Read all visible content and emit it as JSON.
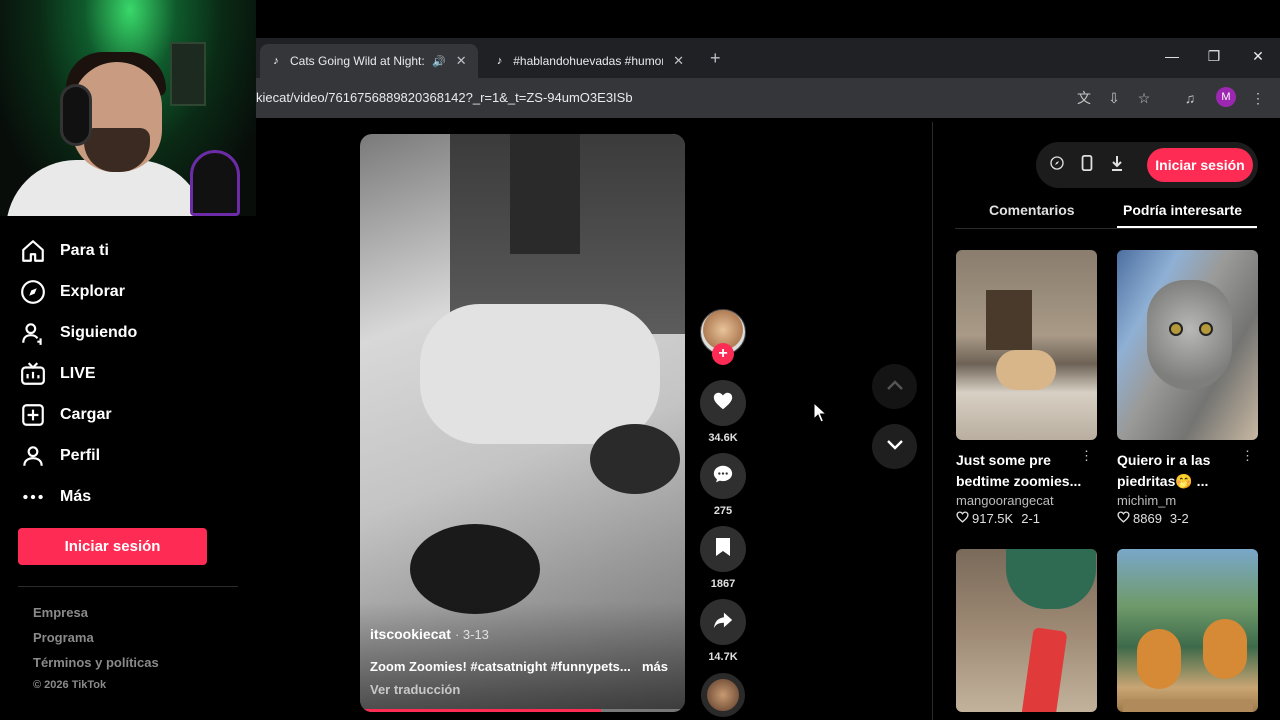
{
  "browser": {
    "tabs": [
      {
        "title": "Cats Going Wild at Night: T",
        "active": true
      },
      {
        "title": "#hablandohuevadas #humor | I",
        "active": false
      }
    ],
    "url": "kiecat/video/7616756889820368142?_r=1&_t=ZS-94umO3E3ISb",
    "profile_initial": "M"
  },
  "sidebar": {
    "items": [
      {
        "label": "Para ti",
        "icon": "home-icon"
      },
      {
        "label": "Explorar",
        "icon": "compass-icon"
      },
      {
        "label": "Siguiendo",
        "icon": "following-icon"
      },
      {
        "label": "LIVE",
        "icon": "live-icon"
      },
      {
        "label": "Cargar",
        "icon": "upload-icon"
      },
      {
        "label": "Perfil",
        "icon": "profile-icon"
      },
      {
        "label": "Más",
        "icon": "more-icon"
      }
    ],
    "login_label": "Iniciar sesión",
    "footer": [
      "Empresa",
      "Programa",
      "Términos y políticas"
    ],
    "copyright": "© 2026 TikTok"
  },
  "video": {
    "author": "itscookiecat",
    "date": "· 3-13",
    "description": "Zoom Zoomies! #catsatnight #funnypets...",
    "more_label": "más",
    "translate_label": "Ver traducción",
    "progress": 0.74
  },
  "actions": {
    "likes": "34.6K",
    "comments": "275",
    "saves": "1867",
    "shares": "14.7K"
  },
  "right_panel": {
    "login_label": "Iniciar sesión",
    "tabs": [
      {
        "label": "Comentarios",
        "active": false
      },
      {
        "label": "Podría interesarte",
        "active": true
      }
    ],
    "cards": [
      {
        "title": "Just some pre bedtime zoomies...",
        "author": "mangoorangecat",
        "likes": "917.5K",
        "date": "2-1"
      },
      {
        "title": "Quiero ir a las piedritas🤭 ...",
        "author": "michim_m",
        "likes": "8869",
        "date": "3-2"
      },
      {
        "title": "",
        "author": "",
        "likes": "",
        "date": ""
      },
      {
        "title": "",
        "author": "",
        "likes": "",
        "date": ""
      }
    ]
  },
  "colors": {
    "accent": "#fe2c55",
    "background": "#000000",
    "chrome": "#35363a"
  }
}
